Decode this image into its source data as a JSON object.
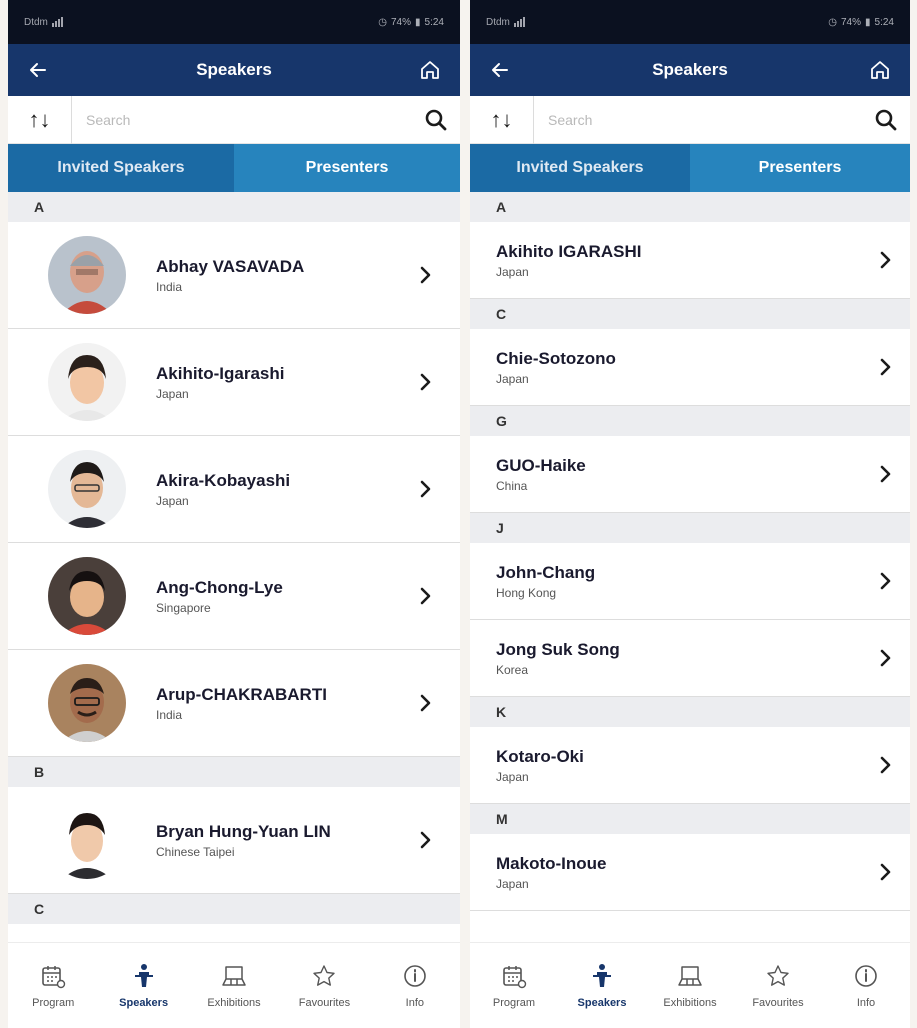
{
  "status_bar": {
    "left_text": "Dtdm",
    "battery": "74%",
    "time": "5:24"
  },
  "header": {
    "title": "Speakers"
  },
  "search": {
    "placeholder": "Search",
    "sort_label": "↑↓"
  },
  "tabs": [
    {
      "label": "Invited Speakers",
      "active": true
    },
    {
      "label": "Presenters",
      "active": false
    }
  ],
  "left_list": {
    "sections": [
      {
        "letter": "A",
        "speakers": [
          {
            "name": "Abhay VASAVADA",
            "country": "India"
          },
          {
            "name": "Akihito-Igarashi",
            "country": "Japan"
          },
          {
            "name": "Akira-Kobayashi",
            "country": "Japan"
          },
          {
            "name": "Ang-Chong-Lye",
            "country": "Singapore"
          },
          {
            "name": "Arup-CHAKRABARTI",
            "country": "India"
          }
        ]
      },
      {
        "letter": "B",
        "speakers": [
          {
            "name": "Bryan Hung-Yuan LIN",
            "country": "Chinese Taipei"
          }
        ]
      },
      {
        "letter": "C",
        "speakers": []
      }
    ]
  },
  "right_list": {
    "sections": [
      {
        "letter": "A",
        "speakers": [
          {
            "name": "Akihito IGARASHI",
            "country": "Japan"
          }
        ]
      },
      {
        "letter": "C",
        "speakers": [
          {
            "name": "Chie-Sotozono",
            "country": "Japan"
          }
        ]
      },
      {
        "letter": "G",
        "speakers": [
          {
            "name": "GUO-Haike",
            "country": "China"
          }
        ]
      },
      {
        "letter": "J",
        "speakers": [
          {
            "name": "John-Chang",
            "country": "Hong Kong"
          },
          {
            "name": "Jong Suk Song",
            "country": "Korea"
          }
        ]
      },
      {
        "letter": "K",
        "speakers": [
          {
            "name": "Kotaro-Oki",
            "country": "Japan"
          }
        ]
      },
      {
        "letter": "M",
        "speakers": [
          {
            "name": "Makoto-Inoue",
            "country": "Japan"
          }
        ]
      }
    ]
  },
  "bottom_nav": [
    {
      "label": "Program",
      "icon": "calendar-icon",
      "active": false
    },
    {
      "label": "Speakers",
      "icon": "speaker-podium-icon",
      "active": true
    },
    {
      "label": "Exhibitions",
      "icon": "exhibition-booth-icon",
      "active": false
    },
    {
      "label": "Favourites",
      "icon": "star-icon",
      "active": false
    },
    {
      "label": "Info",
      "icon": "info-icon",
      "active": false
    }
  ],
  "colors": {
    "header_navy": "#17366b",
    "tab_active": "#1b6aa4",
    "tab_inactive": "#2784bd",
    "section_bg": "#ecedf0"
  }
}
